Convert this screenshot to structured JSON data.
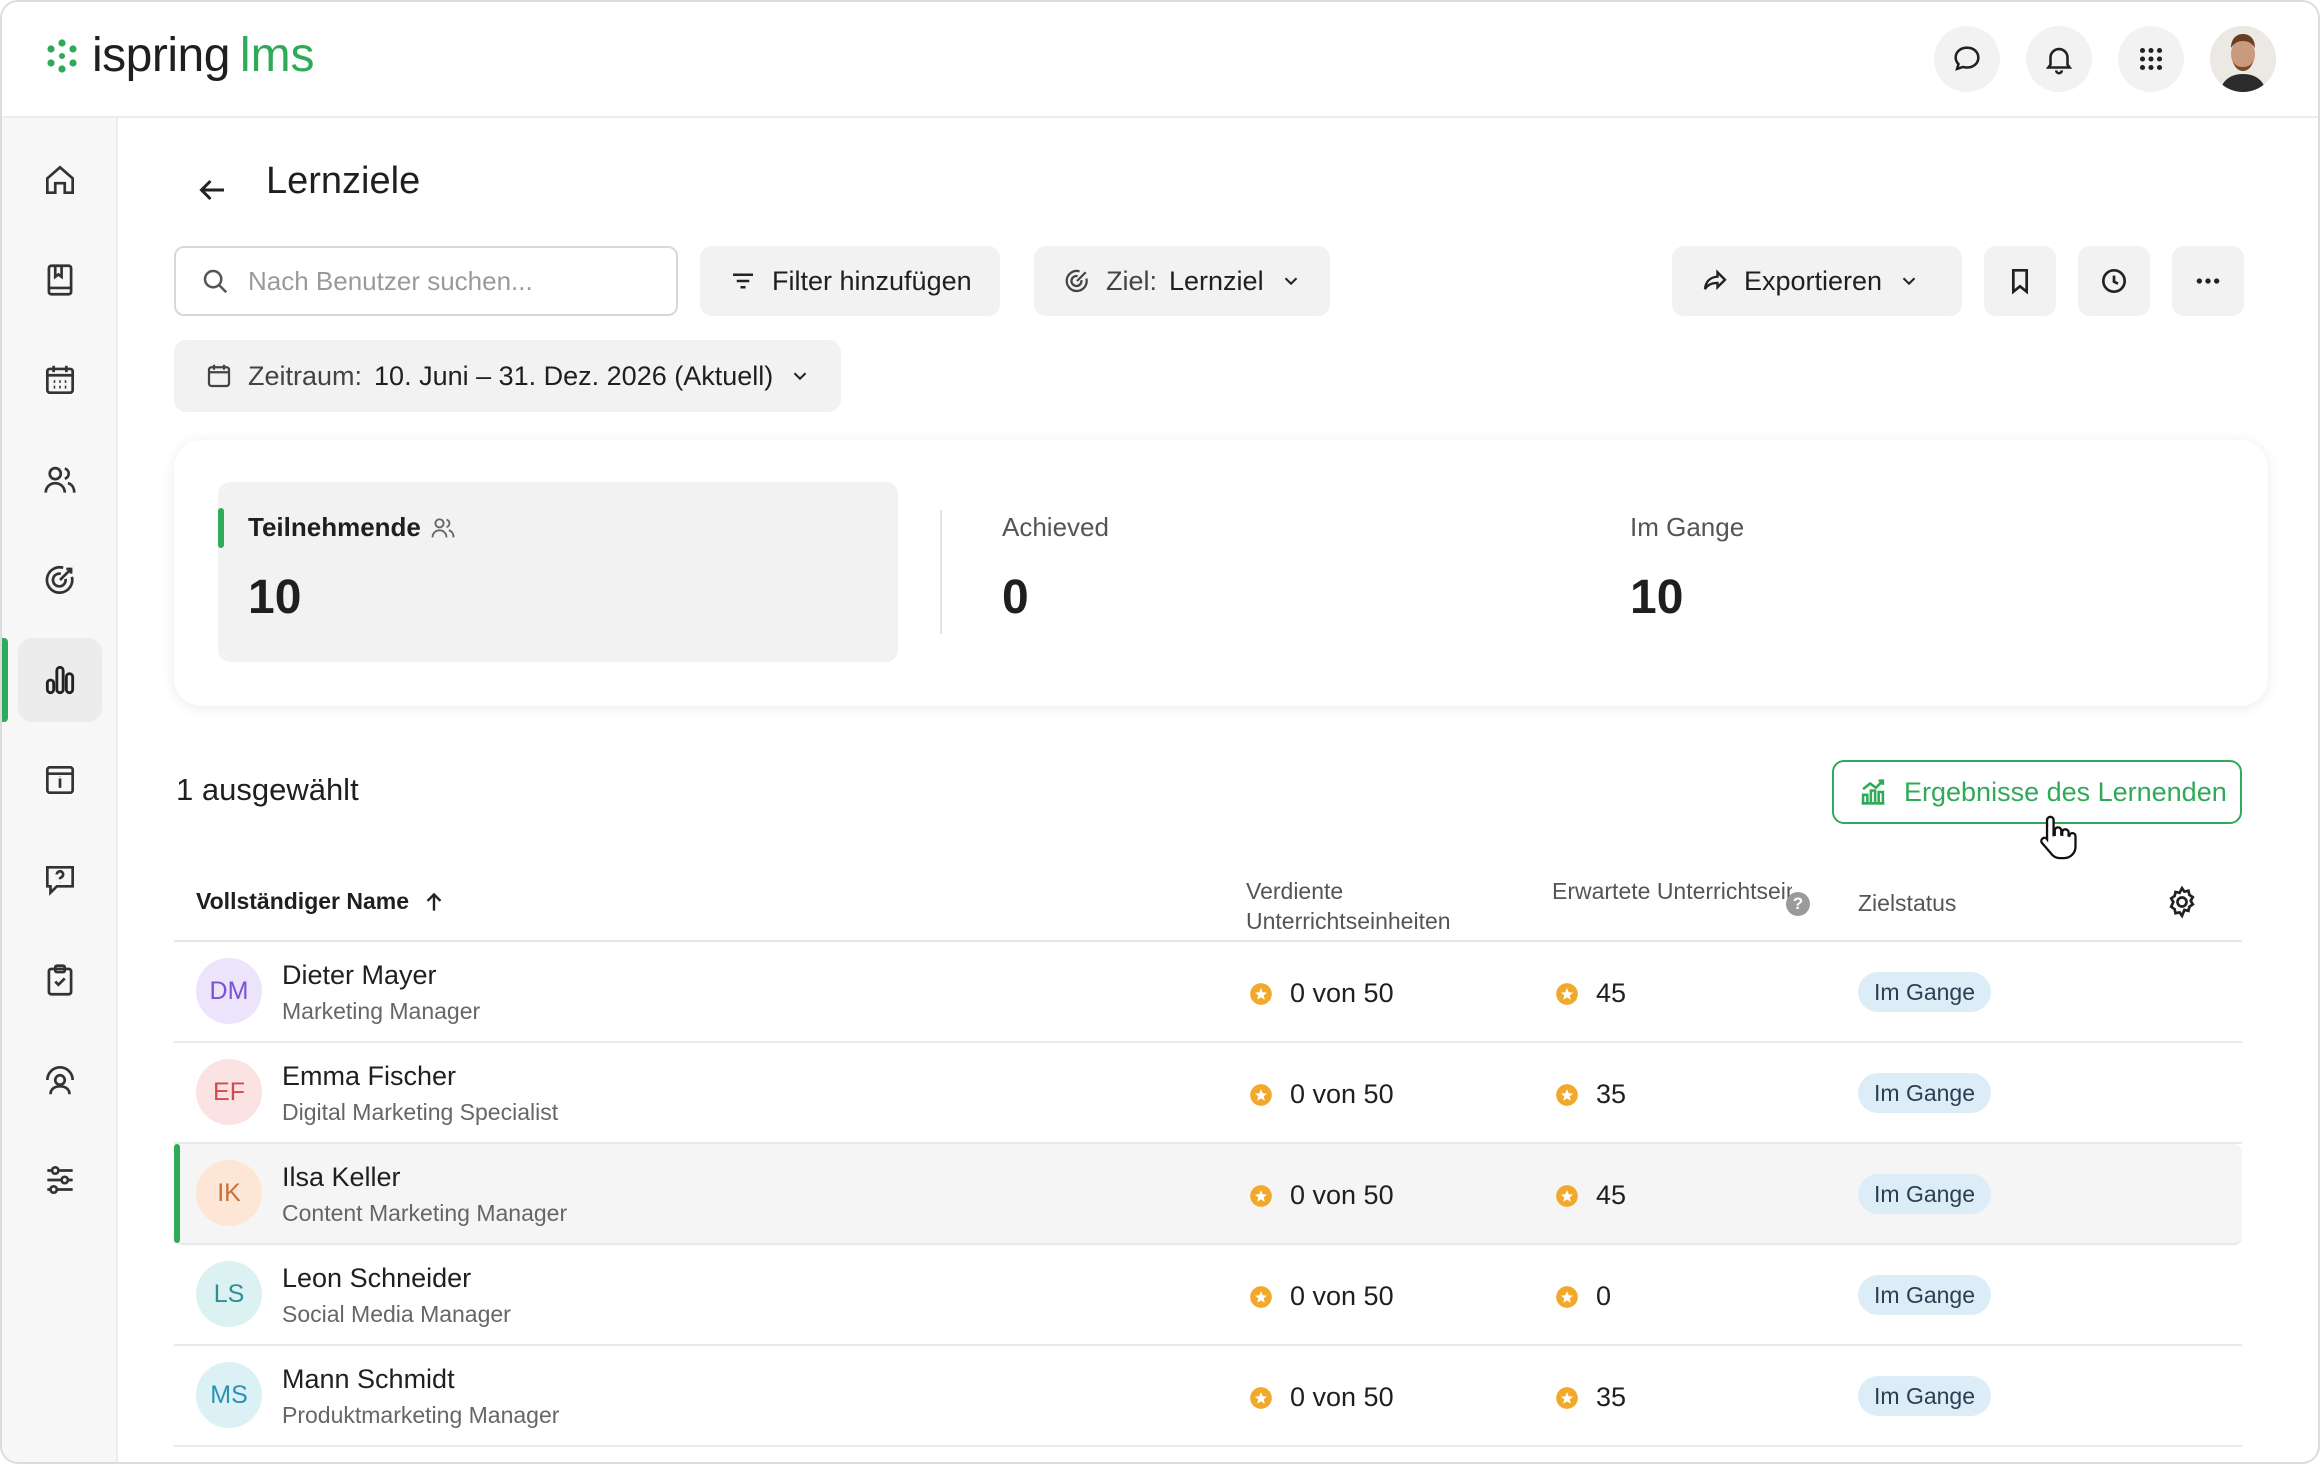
{
  "header": {
    "brand": "ispring",
    "brand_suffix": "lms",
    "icons": [
      "chat-icon",
      "bell-icon",
      "apps-grid-icon",
      "user-avatar"
    ]
  },
  "sidebar": {
    "items": [
      "home-icon",
      "book-icon",
      "calendar-icon",
      "users-icon",
      "target-icon",
      "reports-icon",
      "info-card-icon",
      "help-message-icon",
      "clipboard-check-icon",
      "support-user-icon",
      "settings-sliders-icon"
    ],
    "active": "reports-icon"
  },
  "page": {
    "title": "Lernziele"
  },
  "toolbar": {
    "search_placeholder": "Nach Benutzer suchen...",
    "filter_label": "Filter hinzufügen",
    "goal_prefix": "Ziel:",
    "goal_value": "Lernziel",
    "export_label": "Exportieren",
    "period_prefix": "Zeitraum:",
    "period_value": "10. Juni – 31. Dez. 2026 (Aktuell)"
  },
  "stats": {
    "participants": {
      "label": "Teilnehmende",
      "value": "10"
    },
    "achieved": {
      "label": "Achieved",
      "value": "0"
    },
    "in_progress": {
      "label": "Im Gange",
      "value": "10"
    }
  },
  "selection": {
    "count_label": "1 ausgewählt",
    "results_button": "Ergebnisse des Lernenden"
  },
  "table": {
    "columns": {
      "name": "Vollständiger Name",
      "earned": "Verdiente Unterrichtseinheiten",
      "expected": "Erwartete Unterrichtseinheit...",
      "help": "?",
      "status": "Zielstatus"
    },
    "rows": [
      {
        "initials": "DM",
        "name": "Dieter Mayer",
        "role": "Marketing Manager",
        "earned": "0 von 50",
        "expected": "45",
        "status": "Im Gange",
        "avatar_bg": "#ebe4fb",
        "avatar_fg": "#7a52d4"
      },
      {
        "initials": "EF",
        "name": "Emma Fischer",
        "role": "Digital Marketing Specialist",
        "earned": "0 von 50",
        "expected": "35",
        "status": "Im Gange",
        "avatar_bg": "#fbe3e3",
        "avatar_fg": "#d24a4a"
      },
      {
        "initials": "IK",
        "name": "Ilsa Keller",
        "role": "Content Marketing Manager",
        "earned": "0 von 50",
        "expected": "45",
        "status": "Im Gange",
        "avatar_bg": "#fde6d6",
        "avatar_fg": "#c9703a"
      },
      {
        "initials": "LS",
        "name": "Leon Schneider",
        "role": "Social Media Manager",
        "earned": "0 von 50",
        "expected": "0",
        "status": "Im Gange",
        "avatar_bg": "#dcf1f2",
        "avatar_fg": "#2e8f97"
      },
      {
        "initials": "MS",
        "name": "Mann Schmidt",
        "role": "Produktmarketing Manager",
        "earned": "0 von 50",
        "expected": "35",
        "status": "Im Gange",
        "avatar_bg": "#dcf1f6",
        "avatar_fg": "#2a93b2"
      }
    ],
    "selected_row": 2
  },
  "colors": {
    "accent": "#2faa58",
    "badge_bg": "#dcedf8",
    "coin": "#f2a92b"
  }
}
